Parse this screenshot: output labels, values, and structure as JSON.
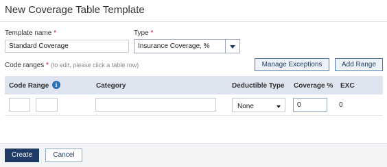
{
  "page": {
    "title": "New Coverage Table Template"
  },
  "form": {
    "template_name": {
      "label": "Template name",
      "required_mark": "*",
      "value": "Standard Coverage"
    },
    "type": {
      "label": "Type",
      "required_mark": "*",
      "value": "Insurance Coverage, %"
    },
    "code_ranges": {
      "label": "Code ranges",
      "required_mark": "*",
      "hint": "(to edit, please click a table row)"
    },
    "buttons": {
      "manage_exceptions": "Manage Exceptions",
      "add_range": "Add Range"
    }
  },
  "table": {
    "headers": {
      "code_range": "Code Range",
      "category": "Category",
      "deductible_type": "Deductible Type",
      "coverage": "Coverage %",
      "exc": "EXC"
    },
    "info_icon_glyph": "i",
    "rows": [
      {
        "code_from": "",
        "separator": "-",
        "code_to": "",
        "category": "",
        "deductible_type": "None",
        "coverage": "0",
        "exc": "0"
      }
    ]
  },
  "footer": {
    "create_label": "Create",
    "cancel_label": "Cancel"
  },
  "colors": {
    "primary": "#1f3c66",
    "accent": "#2e6eb5",
    "required": "#d0021b",
    "table_header_bg": "#dde4ef"
  }
}
